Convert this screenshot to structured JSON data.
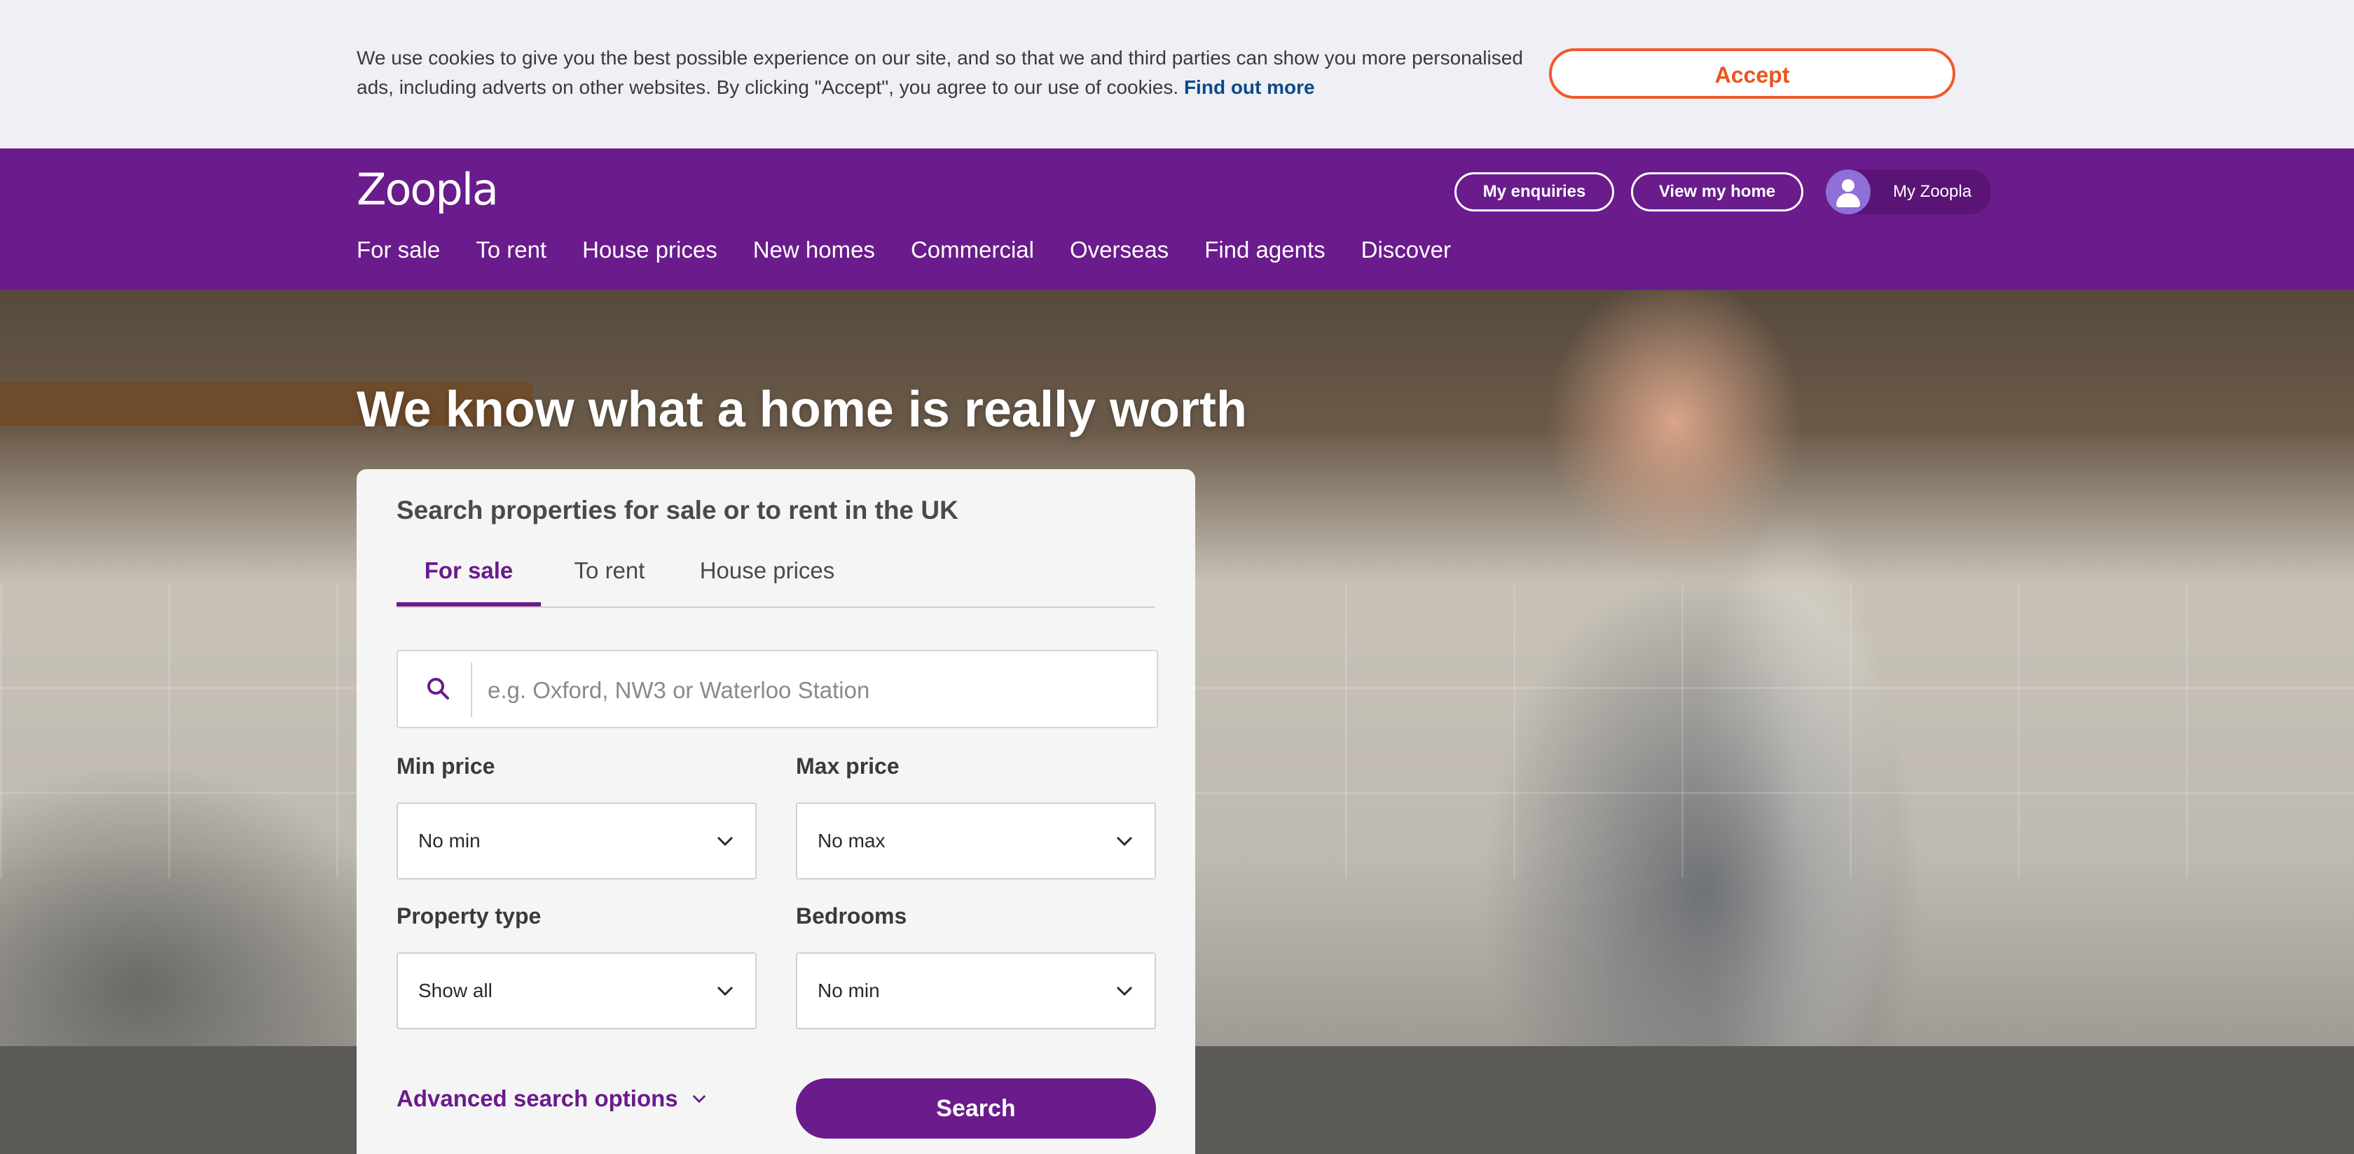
{
  "cookie_banner": {
    "text": "We use cookies to give you the best possible experience on our site, and so that we and third parties can show you more personalised ads, including adverts on other websites. By clicking \"Accept\", you agree to our use of cookies.",
    "link_label": "Find out more",
    "accept_label": "Accept"
  },
  "header": {
    "logo": "Zoopla",
    "my_enquiries_label": "My enquiries",
    "view_my_home_label": "View my home",
    "my_zoopla_label": "My Zoopla",
    "nav": [
      "For sale",
      "To rent",
      "House prices",
      "New homes",
      "Commercial",
      "Overseas",
      "Find agents",
      "Discover"
    ]
  },
  "hero": {
    "title": "We know what a home is really worth"
  },
  "search_panel": {
    "title": "Search properties for sale or to rent in the UK",
    "tabs": [
      "For sale",
      "To rent",
      "House prices"
    ],
    "active_tab": "For sale",
    "search_placeholder": "e.g. Oxford, NW3 or Waterloo Station",
    "search_value": "",
    "min_price": {
      "label": "Min price",
      "value": "No min"
    },
    "max_price": {
      "label": "Max price",
      "value": "No max"
    },
    "property_type": {
      "label": "Property type",
      "value": "Show all"
    },
    "bedrooms": {
      "label": "Bedrooms",
      "value": "No min"
    },
    "advanced_label": "Advanced search options",
    "search_button_label": "Search"
  },
  "colors": {
    "brand_purple": "#6a1b8c",
    "accept_orange": "#f05a28",
    "link_blue": "#0a4a8c"
  },
  "icons": [
    "search-icon",
    "chevron-down-icon",
    "user-avatar-icon"
  ]
}
